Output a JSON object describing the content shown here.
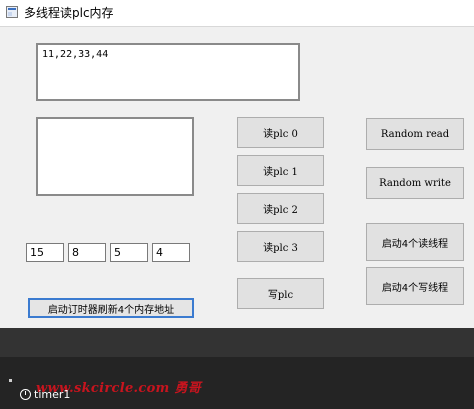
{
  "window": {
    "title": "多线程读plc内存",
    "icon": "form-icon"
  },
  "output_box": {
    "value": "11,22,33,44"
  },
  "log_box": {
    "value": ""
  },
  "address_inputs": [
    {
      "value": "15"
    },
    {
      "value": "8"
    },
    {
      "value": "5"
    },
    {
      "value": "4"
    }
  ],
  "buttons": {
    "start_timer": "启动订时器刷新4个内存地址",
    "read_plc_0": "读plc 0",
    "read_plc_1": "读plc 1",
    "read_plc_2": "读plc 2",
    "read_plc_3": "读plc 3",
    "write_plc": "写plc",
    "random_read": "Random read",
    "random_write": "Random write",
    "start_4_read_threads": "启动4个读线程",
    "start_4_write_threads": "启动4个写线程"
  },
  "component_tray": {
    "timer_label": "timer1",
    "timer_icon": "clock-icon"
  },
  "watermark": {
    "text": "www.skcircle.com 勇哥"
  },
  "colors": {
    "client_bg": "#f0f0f0",
    "button_bg": "#e1e1e1",
    "focus_border": "#3b7bd0",
    "tray_bg": "#333333",
    "watermark": "#c8141e"
  }
}
